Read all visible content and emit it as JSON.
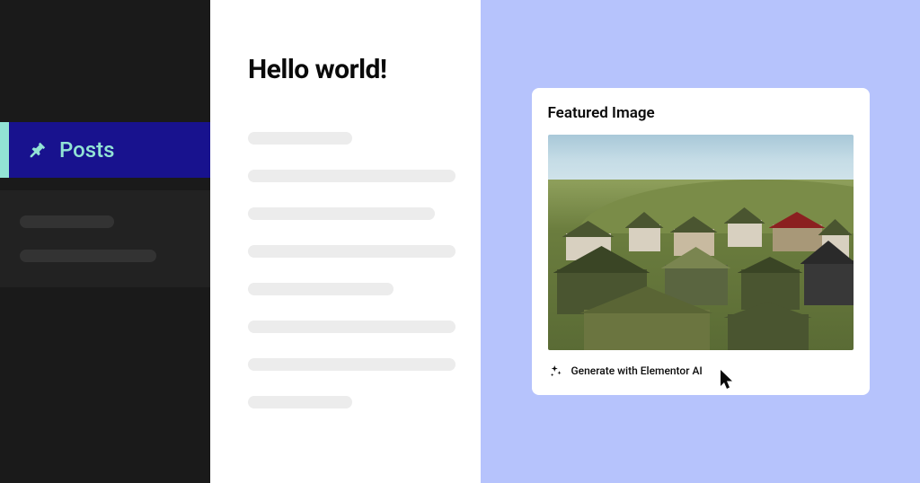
{
  "sidebar": {
    "active_item": {
      "label": "Posts"
    }
  },
  "editor": {
    "title": "Hello world!"
  },
  "featured": {
    "title": "Featured Image",
    "generate_label": "Generate with Elementor AI"
  }
}
